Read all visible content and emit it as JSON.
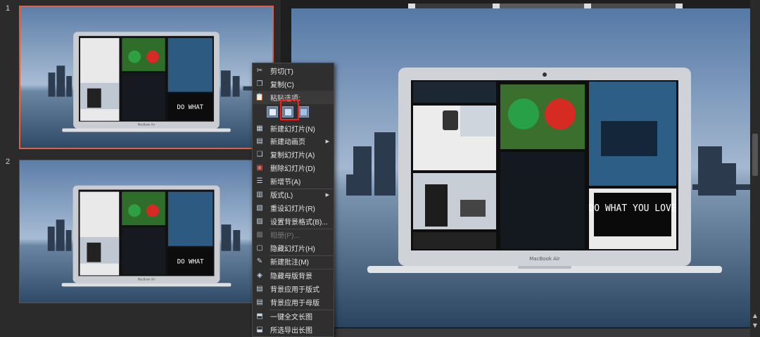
{
  "thumbnails": [
    {
      "number": "1",
      "selected": true,
      "device_text": "MacBook Air"
    },
    {
      "number": "2",
      "selected": false,
      "device_text": "MacBook Air"
    }
  ],
  "main_slide": {
    "device_text": "MacBook Air",
    "poster_text": "DO WHAT YOU LOVE"
  },
  "context_menu": {
    "items": [
      {
        "name": "cut",
        "label": "剪切(T)",
        "icon": "scissors-icon"
      },
      {
        "name": "copy",
        "label": "复制(C)",
        "icon": "copy-icon"
      },
      {
        "name": "paste-options",
        "label": "粘贴选项:",
        "icon": "paste-icon",
        "header": true
      },
      {
        "name": "new-slide",
        "label": "新建幻灯片(N)",
        "icon": "new-slide-icon"
      },
      {
        "name": "new-animation-page",
        "label": "新建动画页",
        "icon": "animation-page-icon",
        "submenu": true
      },
      {
        "name": "duplicate-slide",
        "label": "复制幻灯片(A)",
        "icon": "duplicate-slide-icon"
      },
      {
        "name": "delete-slide",
        "label": "删除幻灯片(D)",
        "icon": "delete-slide-icon"
      },
      {
        "name": "new-section",
        "label": "新增节(A)",
        "icon": "section-icon"
      },
      {
        "name": "layout",
        "label": "版式(L)",
        "icon": "layout-icon",
        "submenu": true
      },
      {
        "name": "reset-slide",
        "label": "重设幻灯片(R)",
        "icon": "reset-icon"
      },
      {
        "name": "format-background",
        "label": "设置背景格式(B)...",
        "icon": "background-format-icon"
      },
      {
        "name": "photo-album",
        "label": "相册(P)...",
        "icon": "album-icon",
        "disabled": true
      },
      {
        "name": "hide-slide",
        "label": "隐藏幻灯片(H)",
        "icon": "hide-slide-icon"
      },
      {
        "name": "new-comment",
        "label": "新建批注(M)",
        "icon": "comment-icon"
      },
      {
        "name": "hide-master-background",
        "label": "隐藏母版背景",
        "icon": "hide-master-icon"
      },
      {
        "name": "apply-bg-layout",
        "label": "背景应用于版式",
        "icon": "apply-layout-icon"
      },
      {
        "name": "apply-bg-master",
        "label": "背景应用于母版",
        "icon": "apply-master-icon"
      },
      {
        "name": "one-click-long-image",
        "label": "一键全文长图",
        "icon": "long-image-icon"
      },
      {
        "name": "export-selected-long-image",
        "label": "所选导出长图",
        "icon": "export-image-icon"
      }
    ],
    "paste_buttons": [
      "use-destination-theme-icon",
      "keep-source-formatting-icon",
      "picture-icon"
    ],
    "highlight_color": "#ff1a1a"
  },
  "colors": {
    "selection_border": "#e0603f",
    "menu_bg": "#2f2f2f",
    "pane_bg": "#2b2b2b"
  }
}
